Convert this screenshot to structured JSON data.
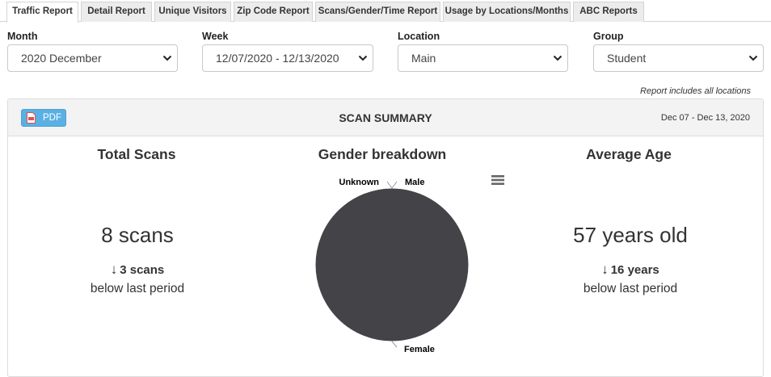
{
  "tabs": [
    {
      "label": "Traffic Report",
      "active": true
    },
    {
      "label": "Detail Report"
    },
    {
      "label": "Unique Visitors"
    },
    {
      "label": "Zip Code Report"
    },
    {
      "label": "Scans/Gender/Time Report"
    },
    {
      "label": "Usage by Locations/Months"
    },
    {
      "label": "ABC Reports"
    }
  ],
  "filters": {
    "month": {
      "label": "Month",
      "value": "2020 December"
    },
    "week": {
      "label": "Week",
      "value": "12/07/2020 - 12/13/2020"
    },
    "location": {
      "label": "Location",
      "value": "Main"
    },
    "group": {
      "label": "Group",
      "value": "Student"
    }
  },
  "note": "Report includes all locations",
  "summary": {
    "pdf_label": "PDF",
    "title": "SCAN SUMMARY",
    "date_range": "Dec 07 - Dec 13, 2020",
    "total_scans": {
      "title": "Total Scans",
      "value": "8 scans",
      "arrow": "↓",
      "delta": "3 scans",
      "delta_note": "below last period"
    },
    "gender": {
      "title": "Gender breakdown"
    },
    "average_age": {
      "title": "Average Age",
      "value": "57 years old",
      "arrow": "↓",
      "delta": "16 years",
      "delta_note": "below last period"
    }
  },
  "chart_data": {
    "type": "pie",
    "title": "Gender breakdown",
    "series": [
      {
        "name": "Unknown",
        "value": 0
      },
      {
        "name": "Male",
        "value": 0
      },
      {
        "name": "Female",
        "value": 8
      }
    ],
    "colors": {
      "Female": "#434348",
      "Male": "#90ed7d",
      "Unknown": "#7cb5ec"
    }
  },
  "colors": {
    "pdf_button": "#5bb0e3",
    "panel_header": "#f3f3f3",
    "pie_fill": "#434348"
  }
}
